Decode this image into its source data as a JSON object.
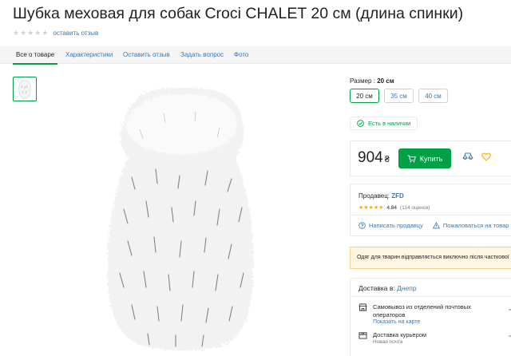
{
  "product": {
    "title": "Шубка меховая для собак Croci CHALET 20 см (длина спинки)",
    "review_link": "оставить отзыв"
  },
  "tabs": [
    {
      "label": "Все о товаре",
      "active": true
    },
    {
      "label": "Характеристики"
    },
    {
      "label": "Оставить отзыв"
    },
    {
      "label": "Задать вопрос"
    },
    {
      "label": "Фото"
    }
  ],
  "size": {
    "label": "Размер :",
    "selected": "20 см",
    "options": [
      "20 см",
      "35 см",
      "40 см"
    ]
  },
  "stock": {
    "text": "Есть в наличии"
  },
  "price": {
    "value": "904",
    "currency": "₴"
  },
  "buy": {
    "label": "Купить"
  },
  "seller": {
    "label": "Продавец:",
    "name": "ZFD",
    "rating": "4.84",
    "reviews": "(114 оценок)",
    "write": "Написать продавцу",
    "complain": "Пожаловаться на товар"
  },
  "notice": {
    "text": "Одяг для тварин відправляється виключно після часткової"
  },
  "delivery": {
    "label": "Доставка в:",
    "city": "Днепр",
    "pickup_title": "Самовывоз из отделений почтовых операторов",
    "pickup_link": "Показать на карте",
    "courier_title": "Доставка курьером",
    "courier_sub": "Новая почта"
  },
  "icons": [
    "heart-icon",
    "compare-icon",
    "cart-icon",
    "check-circle-icon",
    "question-icon",
    "warning-icon",
    "store-icon",
    "box-icon",
    "chevron-down-icon"
  ],
  "colors": {
    "accent": "#00a046",
    "link": "#3e77aa",
    "star": "#ffa900",
    "notice_bg": "#fff5e3"
  }
}
